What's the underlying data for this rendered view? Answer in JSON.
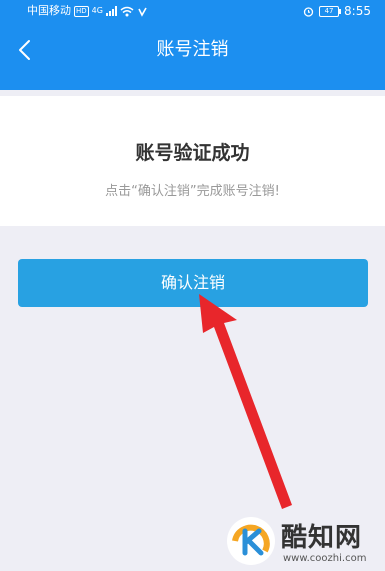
{
  "status_bar": {
    "carrier": "中国移动",
    "hd_badge": "HD",
    "network": "4G",
    "battery": "47",
    "time": "8:55"
  },
  "nav": {
    "title": "账号注销",
    "back_icon": "chevron-left-icon"
  },
  "result": {
    "title": "账号验证成功",
    "subtitle": "点击“确认注销”完成账号注销!"
  },
  "confirm_button": {
    "label": "确认注销"
  },
  "watermark": {
    "name": "酷知网",
    "url": "www.coozhi.com"
  },
  "colors": {
    "header": "#1c8ff0",
    "button": "#28a1e2",
    "background": "#eeeef5",
    "arrow": "#e8262b"
  }
}
